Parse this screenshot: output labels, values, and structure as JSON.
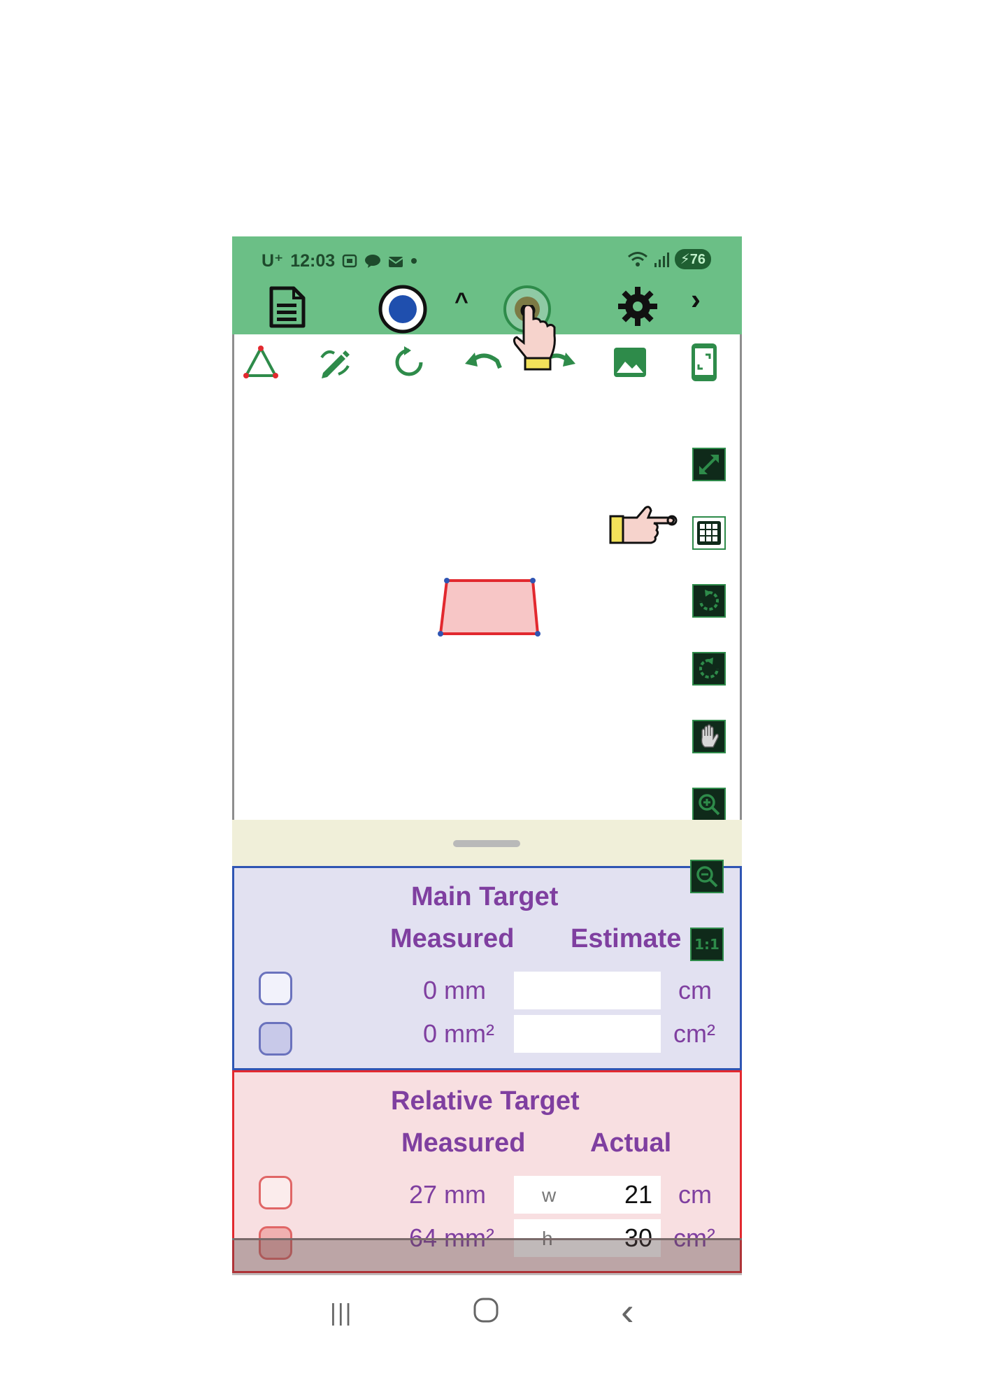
{
  "status_bar": {
    "carrier": "U⁺",
    "time": "12:03",
    "battery": "76"
  },
  "top_toolbar": {
    "icons": [
      "document-icon",
      "blue-record-button",
      "chevron-up-icon",
      "olive-record-button",
      "gear-icon",
      "chevron-right-icon"
    ],
    "chevron_up": "^",
    "chevron_right": "›"
  },
  "drawing_tools": [
    "triangle-tool-icon",
    "edit-pencil-icon",
    "reset-rotate-icon",
    "undo-icon",
    "redo-icon",
    "image-icon",
    "phone-frame-icon"
  ],
  "side_tools": {
    "icons": [
      "expand-icon",
      "grid-icon",
      "rotate-cw-icon",
      "rotate-ccw-icon",
      "hand-pan-icon",
      "zoom-in-icon",
      "zoom-out-icon",
      "scale-1to1-icon"
    ],
    "scale_label": "1:1"
  },
  "shape": {
    "fill": "#f7c6c6",
    "stroke": "#e2292f",
    "vertex_color": "#2f55b3"
  },
  "main_target": {
    "title": "Main Target",
    "col_measured": "Measured",
    "col_estimate": "Estimate",
    "rows": [
      {
        "measured": "0  mm",
        "estimate": "",
        "unit": "cm"
      },
      {
        "measured": "0 mm²",
        "estimate": "",
        "unit": "cm²"
      }
    ],
    "accent": "#2f55b3"
  },
  "relative_target": {
    "title": "Relative Target",
    "col_measured": "Measured",
    "col_actual": "Actual",
    "rows": [
      {
        "measured": "27  mm",
        "label": "w",
        "actual": "21",
        "unit": "cm"
      },
      {
        "measured": "64 mm²",
        "label": "h",
        "actual": "30",
        "unit": "cm²"
      }
    ],
    "accent": "#e2292f"
  },
  "nav": {
    "recent": "|||",
    "home": "○",
    "back": "‹"
  },
  "colors": {
    "topbar": "#6bbf86",
    "text_purple": "#7f3fa0",
    "tool_green": "#2e8b4a"
  }
}
